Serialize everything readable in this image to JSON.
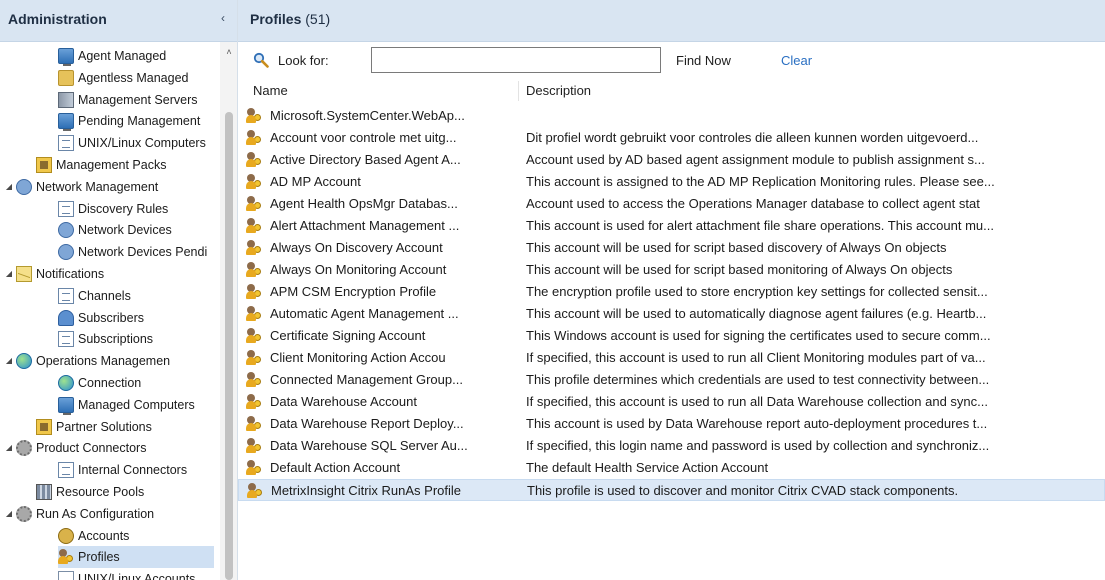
{
  "nav": {
    "title": "Administration",
    "collapse_glyph": "‹",
    "scroll_up_glyph": "˄",
    "items": [
      {
        "label": "Agent Managed",
        "icon": "agent-managed-icon",
        "indent": 3,
        "expander": ""
      },
      {
        "label": "Agentless Managed",
        "icon": "agentless-managed-icon",
        "indent": 3,
        "expander": ""
      },
      {
        "label": "Management Servers",
        "icon": "management-servers-icon",
        "indent": 3,
        "expander": ""
      },
      {
        "label": "Pending Management",
        "icon": "pending-management-icon",
        "indent": 3,
        "expander": ""
      },
      {
        "label": "UNIX/Linux Computers",
        "icon": "unix-linux-computers-icon",
        "indent": 3,
        "expander": ""
      },
      {
        "label": "Management Packs",
        "icon": "management-packs-icon",
        "indent": 2,
        "expander": ""
      },
      {
        "label": "Network Management",
        "icon": "network-management-icon",
        "indent": 1,
        "expander": "◢"
      },
      {
        "label": "Discovery Rules",
        "icon": "discovery-rules-icon",
        "indent": 3,
        "expander": ""
      },
      {
        "label": "Network Devices",
        "icon": "network-devices-icon",
        "indent": 3,
        "expander": ""
      },
      {
        "label": "Network Devices Pendi",
        "icon": "network-devices-pending-icon",
        "indent": 3,
        "expander": ""
      },
      {
        "label": "Notifications",
        "icon": "notifications-icon",
        "indent": 1,
        "expander": "◢"
      },
      {
        "label": "Channels",
        "icon": "channels-icon",
        "indent": 3,
        "expander": ""
      },
      {
        "label": "Subscribers",
        "icon": "subscribers-icon",
        "indent": 3,
        "expander": ""
      },
      {
        "label": "Subscriptions",
        "icon": "subscriptions-icon",
        "indent": 3,
        "expander": ""
      },
      {
        "label": "Operations Managemen",
        "icon": "operations-management-icon",
        "indent": 1,
        "expander": "◢"
      },
      {
        "label": "Connection",
        "icon": "connection-icon",
        "indent": 3,
        "expander": ""
      },
      {
        "label": "Managed Computers",
        "icon": "managed-computers-icon",
        "indent": 3,
        "expander": ""
      },
      {
        "label": "Partner Solutions",
        "icon": "partner-solutions-icon",
        "indent": 2,
        "expander": ""
      },
      {
        "label": "Product Connectors",
        "icon": "product-connectors-icon",
        "indent": 1,
        "expander": "◢"
      },
      {
        "label": "Internal Connectors",
        "icon": "internal-connectors-icon",
        "indent": 3,
        "expander": ""
      },
      {
        "label": "Resource Pools",
        "icon": "resource-pools-icon",
        "indent": 2,
        "expander": ""
      },
      {
        "label": "Run As Configuration",
        "icon": "run-as-configuration-icon",
        "indent": 1,
        "expander": "◢"
      },
      {
        "label": "Accounts",
        "icon": "accounts-icon",
        "indent": 3,
        "expander": ""
      },
      {
        "label": "Profiles",
        "icon": "profiles-icon",
        "indent": 3,
        "expander": "",
        "selected": true
      },
      {
        "label": "UNIX/Linux Accounts",
        "icon": "unix-linux-accounts-icon",
        "indent": 3,
        "expander": ""
      }
    ]
  },
  "main": {
    "title": "Profiles",
    "count": "(51)",
    "search": {
      "label": "Look for:",
      "value": "",
      "placeholder": "",
      "find_now": "Find Now",
      "clear": "Clear"
    },
    "columns": {
      "name": "Name",
      "description": "Description"
    },
    "rows": [
      {
        "name": "Microsoft.SystemCenter.WebAp...",
        "description": ""
      },
      {
        "name": "Account voor controle met uitg...",
        "description": "Dit profiel wordt gebruikt voor controles die alleen kunnen worden uitgevoerd..."
      },
      {
        "name": "Active Directory Based Agent A...",
        "description": "Account used by AD based agent assignment module to publish assignment s..."
      },
      {
        "name": "AD MP Account",
        "description": "This account is assigned to the AD MP Replication Monitoring rules. Please see..."
      },
      {
        "name": "Agent Health OpsMgr Databas...",
        "description": "Account used to access the Operations Manager database to collect agent stat"
      },
      {
        "name": "Alert Attachment Management ...",
        "description": "This account is used for alert attachment file share operations. This account mu..."
      },
      {
        "name": "Always On Discovery Account",
        "description": "This account will be used for script based discovery of Always On objects"
      },
      {
        "name": "Always On Monitoring Account",
        "description": "This account will be used for script based monitoring of Always On objects"
      },
      {
        "name": "APM CSM Encryption Profile",
        "description": "The encryption profile used to store encryption key settings for collected sensit..."
      },
      {
        "name": "Automatic Agent Management ...",
        "description": "This account will be used to automatically diagnose agent failures (e.g. Heartb..."
      },
      {
        "name": "Certificate Signing Account",
        "description": "This Windows account is used for signing the certificates used to secure comm..."
      },
      {
        "name": "Client Monitoring Action Accou",
        "description": "If specified, this account is used to run all Client Monitoring modules part of va..."
      },
      {
        "name": "Connected Management Group...",
        "description": "This profile determines which credentials are used to test connectivity between..."
      },
      {
        "name": "Data Warehouse Account",
        "description": "If specified, this account is used to run all Data Warehouse collection and sync..."
      },
      {
        "name": "Data Warehouse Report Deploy...",
        "description": "This account is used by Data Warehouse report auto-deployment procedures t..."
      },
      {
        "name": "Data Warehouse SQL Server Au...",
        "description": "If specified, this login name and password is used by collection and synchroniz..."
      },
      {
        "name": "Default Action Account",
        "description": "The default Health Service Action Account"
      },
      {
        "name": "MetrixInsight Citrix RunAs Profile",
        "description": "This profile is used to discover and monitor Citrix CVAD stack components.",
        "selected": true
      }
    ]
  }
}
